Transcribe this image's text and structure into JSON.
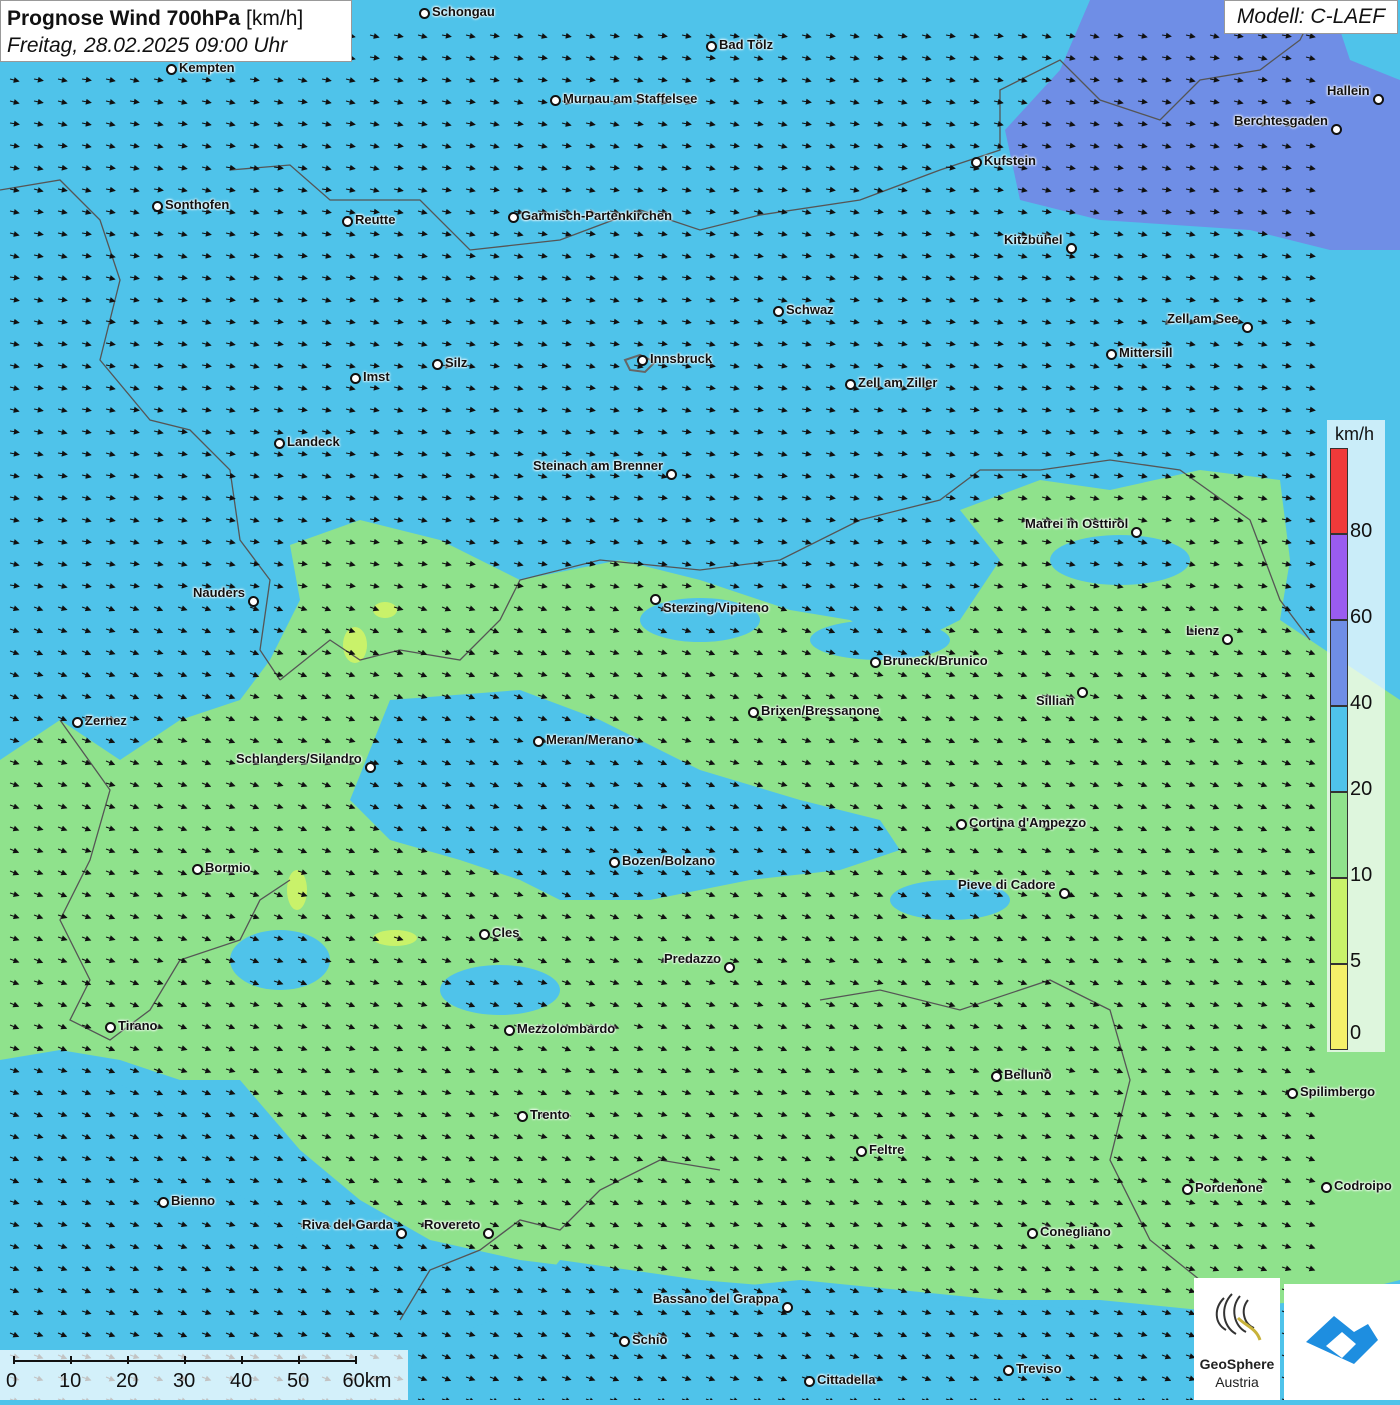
{
  "header": {
    "title_bold": "Prognose Wind 700hPa",
    "title_unit": "[km/h]",
    "subtitle": "Freitag, 28.02.2025 09:00 Uhr",
    "model": "Modell: C-LAEF"
  },
  "colors": {
    "wind_20_40": "#4fc3ea",
    "wind_10_20": "#8fe28c",
    "wind_40_60": "#6f8ee6",
    "wind_5_10": "#c9f26a",
    "wind_0_5": "#f5f06a"
  },
  "legend": {
    "unit": "km/h",
    "ticks": [
      "80",
      "60",
      "40",
      "20",
      "10",
      "5",
      "0"
    ],
    "bands": [
      {
        "label": "80+",
        "color": "#f03a3a"
      },
      {
        "label": "60-80",
        "color": "#9a5cf0"
      },
      {
        "label": "40-60",
        "color": "#6f8ee6"
      },
      {
        "label": "20-40",
        "color": "#4fc3ea"
      },
      {
        "label": "10-20",
        "color": "#8fe28c"
      },
      {
        "label": "5-10",
        "color": "#c9f26a"
      },
      {
        "label": "0-5",
        "color": "#f5f06a"
      }
    ]
  },
  "scalebar": {
    "labels": [
      "0",
      "10",
      "20",
      "30",
      "40",
      "50",
      "60km"
    ]
  },
  "logos": {
    "geosphere_line1": "GeoSphere",
    "geosphere_line2": "Austria",
    "second_logo_icon": "cloud-logo-icon"
  },
  "cities": [
    {
      "name": "Schongau"
    },
    {
      "name": "Bad Tölz"
    },
    {
      "name": "Kempten"
    },
    {
      "name": "Murnau am Staffelsee"
    },
    {
      "name": "Hallein"
    },
    {
      "name": "Berchtesgaden"
    },
    {
      "name": "Kufstein"
    },
    {
      "name": "Sonthofen"
    },
    {
      "name": "Reutte"
    },
    {
      "name": "Garmisch-Partenkirchen"
    },
    {
      "name": "Kitzbühel"
    },
    {
      "name": "Schwaz"
    },
    {
      "name": "Zell am See"
    },
    {
      "name": "Mittersill"
    },
    {
      "name": "Innsbruck"
    },
    {
      "name": "Silz"
    },
    {
      "name": "Imst"
    },
    {
      "name": "Zell am Ziller"
    },
    {
      "name": "Landeck"
    },
    {
      "name": "Steinach am Brenner"
    },
    {
      "name": "Matrei in Osttirol"
    },
    {
      "name": "Nauders"
    },
    {
      "name": "Sterzing/Vipiteno"
    },
    {
      "name": "Lienz"
    },
    {
      "name": "Bruneck/Brunico"
    },
    {
      "name": "Sillian"
    },
    {
      "name": "Brixen/Bressanone"
    },
    {
      "name": "Zernez"
    },
    {
      "name": "Meran/Merano"
    },
    {
      "name": "Schlanders/Silandro"
    },
    {
      "name": "Cortina d'Ampezzo"
    },
    {
      "name": "Bozen/Bolzano"
    },
    {
      "name": "Bormio"
    },
    {
      "name": "Pieve di Cadore"
    },
    {
      "name": "Cles"
    },
    {
      "name": "Predazzo"
    },
    {
      "name": "Tirano"
    },
    {
      "name": "Mezzolombardo"
    },
    {
      "name": "Belluno"
    },
    {
      "name": "Spilimbergo"
    },
    {
      "name": "Trento"
    },
    {
      "name": "Feltre"
    },
    {
      "name": "Bienno"
    },
    {
      "name": "Pordenone"
    },
    {
      "name": "Codroipo"
    },
    {
      "name": "Riva del Garda"
    },
    {
      "name": "Rovereto"
    },
    {
      "name": "Conegliano"
    },
    {
      "name": "Bassano del Grappa"
    },
    {
      "name": "Schio"
    },
    {
      "name": "Treviso"
    },
    {
      "name": "Cittadella"
    }
  ]
}
